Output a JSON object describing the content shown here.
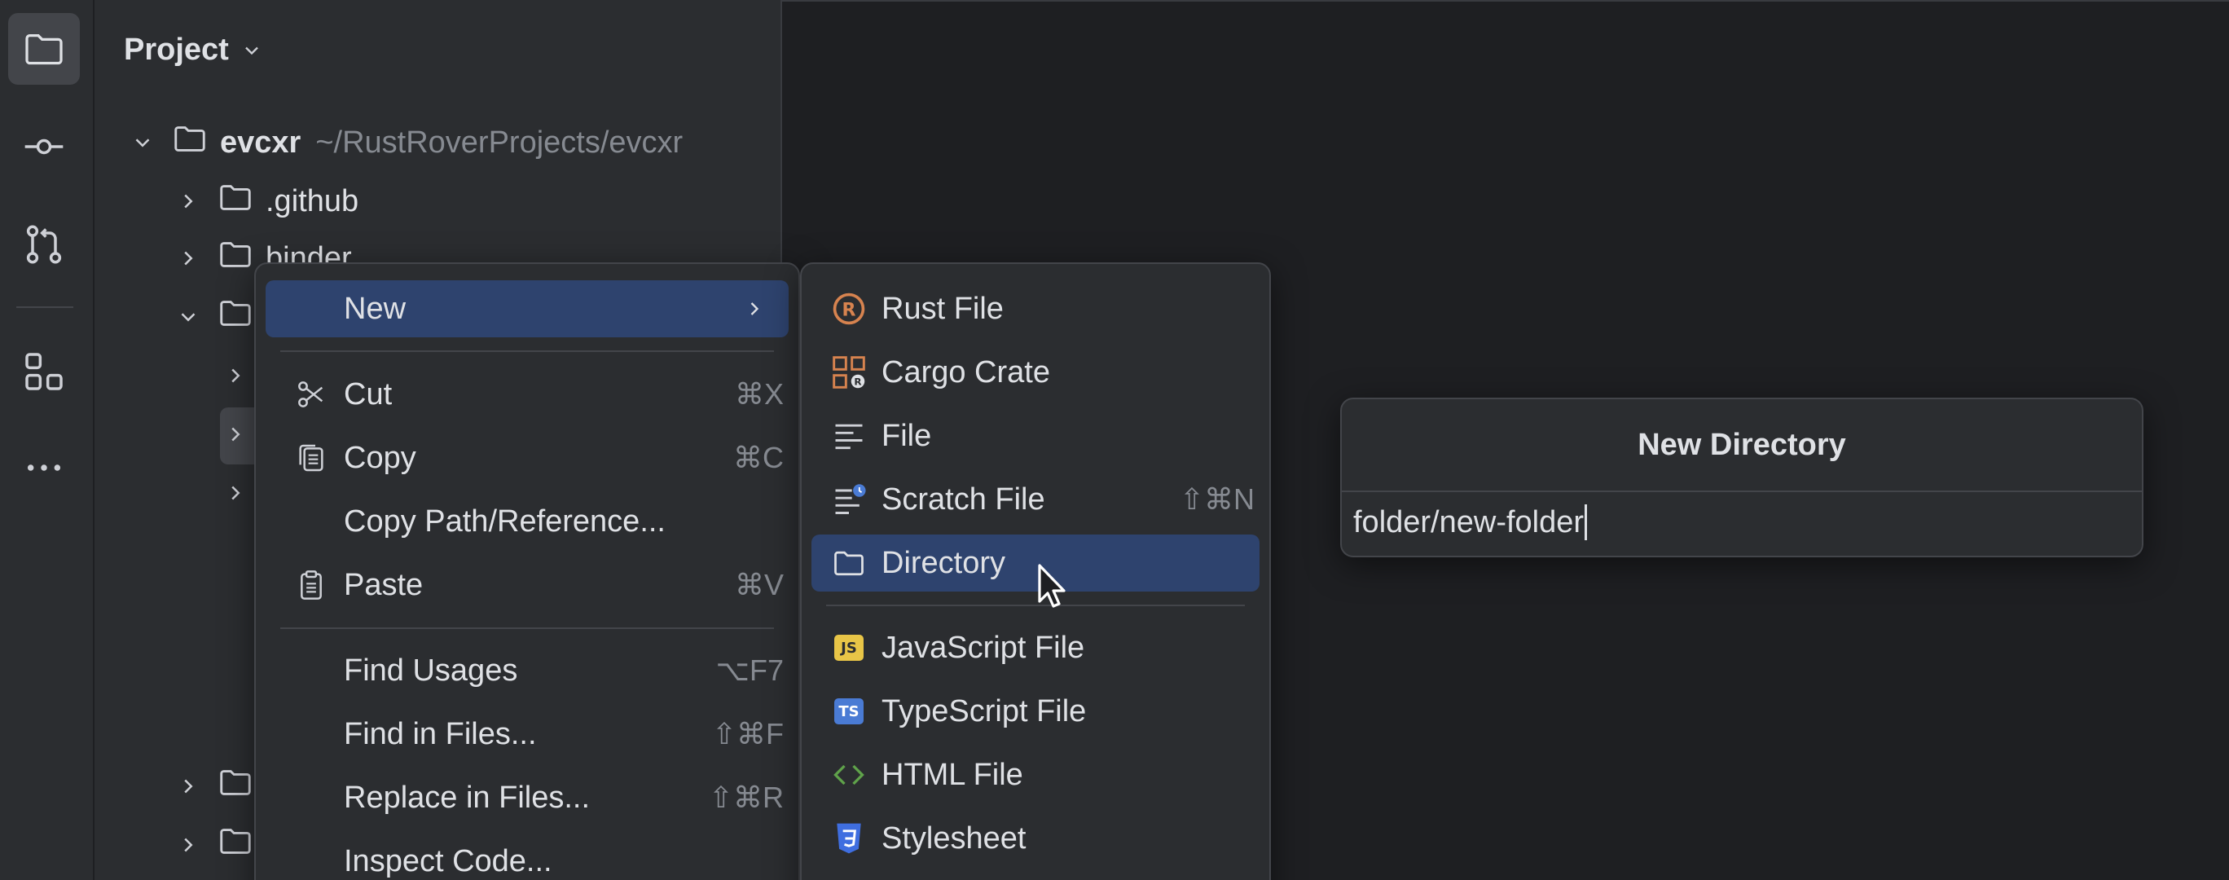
{
  "project_panel": {
    "title": "Project",
    "root": {
      "name": "evcxr",
      "path": "~/RustRoverProjects/evcxr"
    },
    "items": [
      {
        "name": ".github"
      },
      {
        "name": "binder"
      }
    ]
  },
  "context_menu": {
    "items": [
      {
        "label": "New",
        "shortcut": "",
        "icon": ""
      },
      {
        "label": "Cut",
        "shortcut": "⌘X",
        "icon": "scissors-icon"
      },
      {
        "label": "Copy",
        "shortcut": "⌘C",
        "icon": "copy-icon"
      },
      {
        "label": "Copy Path/Reference...",
        "shortcut": "",
        "icon": ""
      },
      {
        "label": "Paste",
        "shortcut": "⌘V",
        "icon": "paste-icon"
      },
      {
        "label": "Find Usages",
        "shortcut": "⌥F7",
        "icon": ""
      },
      {
        "label": "Find in Files...",
        "shortcut": "⇧⌘F",
        "icon": ""
      },
      {
        "label": "Replace in Files...",
        "shortcut": "⇧⌘R",
        "icon": ""
      },
      {
        "label": "Inspect Code...",
        "shortcut": "",
        "icon": ""
      }
    ]
  },
  "new_submenu": {
    "items": [
      {
        "label": "Rust File",
        "shortcut": "",
        "icon": "rust-icon"
      },
      {
        "label": "Cargo Crate",
        "shortcut": "",
        "icon": "cargo-crate-icon"
      },
      {
        "label": "File",
        "shortcut": "",
        "icon": "file-icon"
      },
      {
        "label": "Scratch File",
        "shortcut": "⇧⌘N",
        "icon": "scratch-file-icon"
      },
      {
        "label": "Directory",
        "shortcut": "",
        "icon": "folder-icon"
      },
      {
        "label": "JavaScript File",
        "shortcut": "",
        "icon": "javascript-icon",
        "badge": "JS"
      },
      {
        "label": "TypeScript File",
        "shortcut": "",
        "icon": "typescript-icon",
        "badge": "TS"
      },
      {
        "label": "HTML File",
        "shortcut": "",
        "icon": "html-icon"
      },
      {
        "label": "Stylesheet",
        "shortcut": "",
        "icon": "css-icon"
      }
    ]
  },
  "new_directory": {
    "title": "New Directory",
    "value": "folder/new-folder"
  },
  "colors": {
    "highlight": "#2e436e",
    "background": "#1e1f22",
    "panel": "#2b2d30",
    "rust": "#d7834f",
    "js_badge": "#e8c547",
    "ts_badge": "#4a7bd4",
    "html": "#5fa24a",
    "css": "#3f6ee0"
  }
}
